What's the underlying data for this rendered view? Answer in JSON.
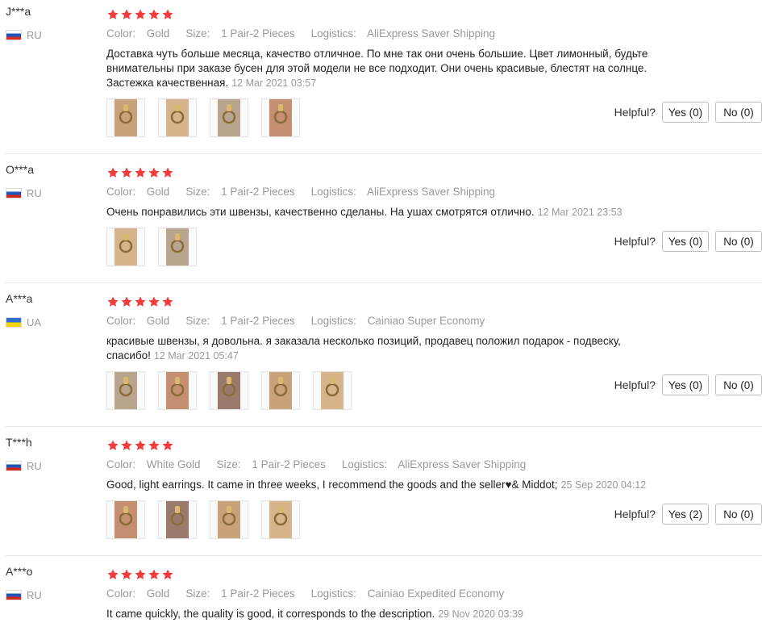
{
  "labels": {
    "helpful": "Helpful?",
    "color_prefix": "Color:",
    "size_prefix": "Size:",
    "logistics_prefix": "Logistics:"
  },
  "colors": {
    "star": "#f03c3c",
    "meta_text": "#999999"
  },
  "reviews": [
    {
      "user": "J***a",
      "country": "RU",
      "flag": "ru",
      "rating": 5,
      "color": "Gold",
      "size": "1 Pair-2 Pieces",
      "logistics": "AliExpress Saver Shipping",
      "text": "Доставка чуть больше месяца, качество отличное. По мне так они очень большие. Цвет лимонный, будьте внимательны при заказе бусен для этой модели не все подходит. Они очень красивые, блестят на солнце. Застежка качественная.",
      "date": "12 Mar 2021 03:57",
      "images": 4,
      "yes": "Yes (0)",
      "no": "No (0)"
    },
    {
      "user": "O***a",
      "country": "RU",
      "flag": "ru",
      "rating": 5,
      "color": "Gold",
      "size": "1 Pair-2 Pieces",
      "logistics": "AliExpress Saver Shipping",
      "text": "Очень понравились эти швензы, качественно сделаны. На ушах смотрятся отлично.",
      "date": "12 Mar 2021 23:53",
      "images": 2,
      "yes": "Yes (0)",
      "no": "No (0)"
    },
    {
      "user": "A***a",
      "country": "UA",
      "flag": "ua",
      "rating": 5,
      "color": "Gold",
      "size": "1 Pair-2 Pieces",
      "logistics": "Cainiao Super Economy",
      "text": "красивые швензы, я довольна. я заказала несколько позиций, продавец положил подарок - подвеску, спасибо!",
      "date": "12 Mar 2021 05:47",
      "images": 5,
      "yes": "Yes (0)",
      "no": "No (0)"
    },
    {
      "user": "T***h",
      "country": "RU",
      "flag": "ru",
      "rating": 5,
      "color": "White Gold",
      "size": "1 Pair-2 Pieces",
      "logistics": "AliExpress Saver Shipping",
      "text": "Good, light earrings. It came in three weeks, I recommend the goods and the seller♥& Middot;",
      "date": "25 Sep 2020 04:12",
      "images": 4,
      "yes": "Yes (2)",
      "no": "No (0)"
    },
    {
      "user": "A***o",
      "country": "RU",
      "flag": "ru",
      "rating": 5,
      "color": "Gold",
      "size": "1 Pair-2 Pieces",
      "logistics": "Cainiao Expedited Economy",
      "text": "It came quickly, the quality is good, it corresponds to the description.",
      "date": "29 Nov 2020 03:39",
      "images": 0,
      "yes": "",
      "no": ""
    }
  ]
}
